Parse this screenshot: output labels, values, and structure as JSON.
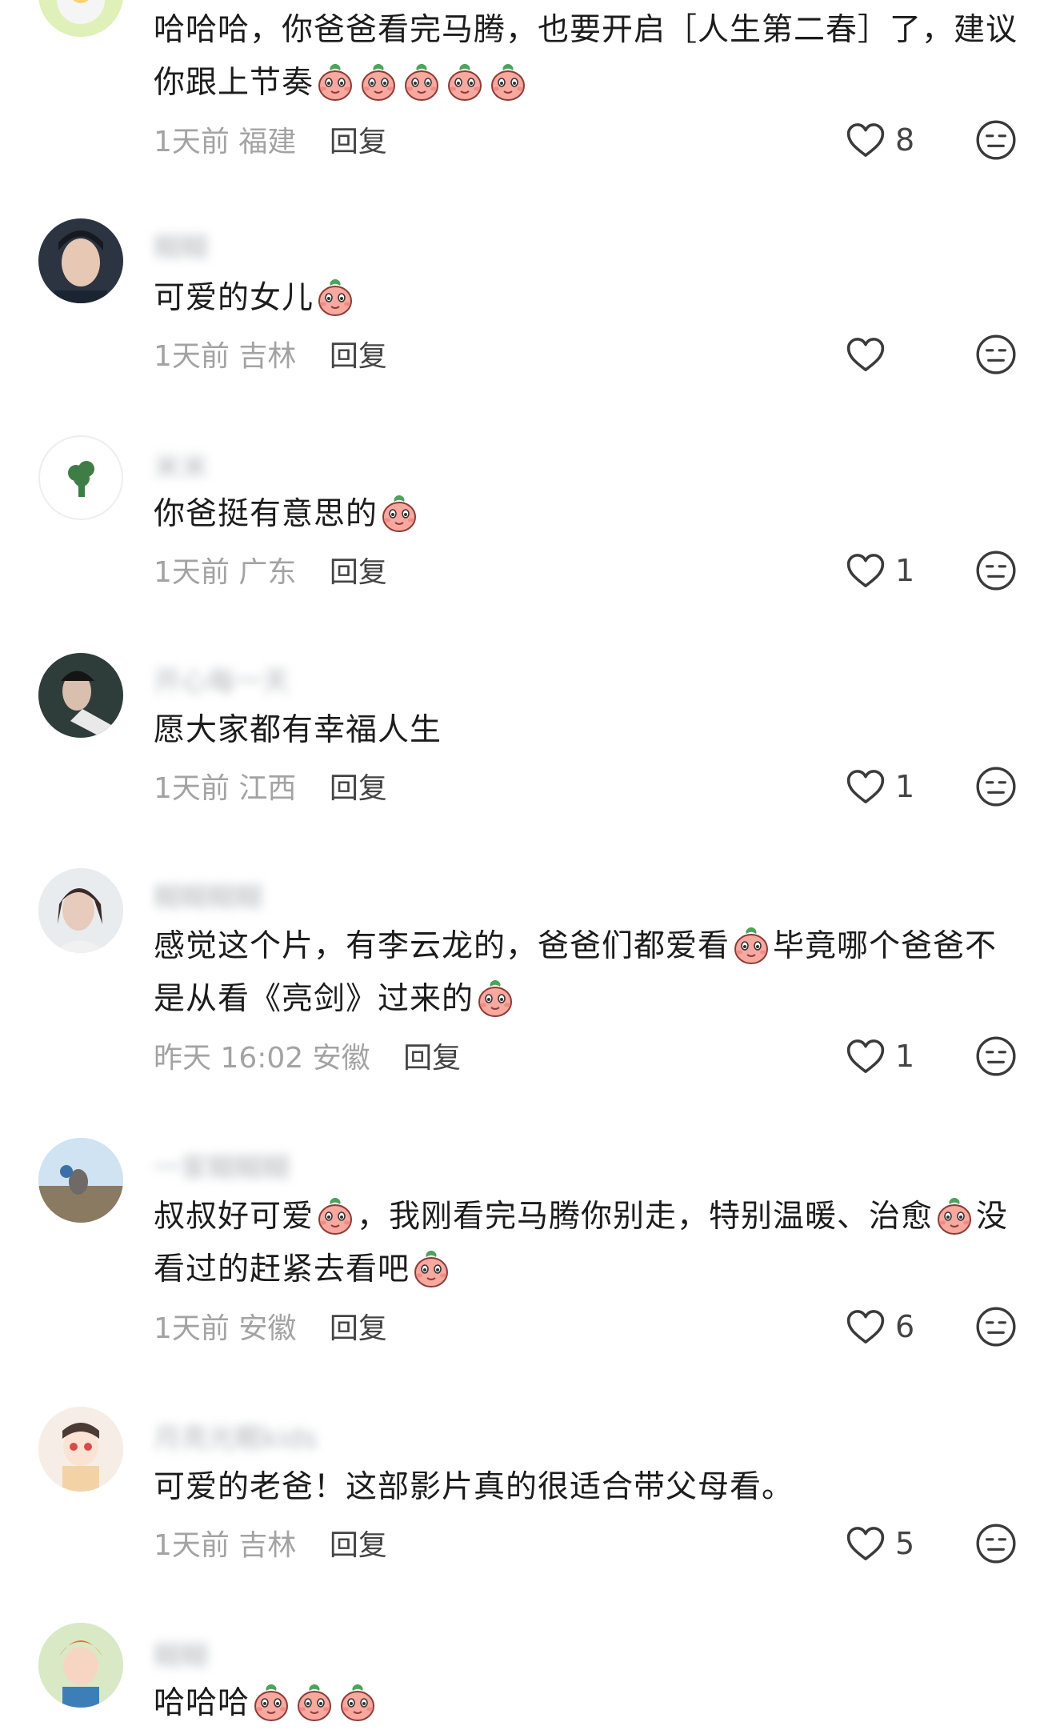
{
  "reply_label": "回复",
  "comments": [
    {
      "username": "blurred-name",
      "text_parts": [
        "哈哈哈，你爸爸看完马腾，也要开启［人生第二春］了，建议你跟上节奏",
        "",
        "",
        "",
        "",
        ""
      ],
      "time": "1天前",
      "location": "福建",
      "likes": "8"
    },
    {
      "username": "糊糊",
      "text_parts": [
        "可爱的女儿",
        ""
      ],
      "time": "1天前",
      "location": "吉林",
      "likes": ""
    },
    {
      "username": "米米",
      "text_parts": [
        "你爸挺有意思的",
        ""
      ],
      "time": "1天前",
      "location": "广东",
      "likes": "1"
    },
    {
      "username": "开心每一天",
      "text_parts": [
        "愿大家都有幸福人生"
      ],
      "time": "1天前",
      "location": "江西",
      "likes": "1"
    },
    {
      "username": "糊糊糊糊",
      "text_parts": [
        "感觉这个片，有李云龙的，爸爸们都爱看",
        "毕竟哪个爸爸不是从看《亮剑》过来的",
        ""
      ],
      "time": "昨天 16:02",
      "location": "安徽",
      "likes": "1"
    },
    {
      "username": "一家糊糊糊",
      "text_parts": [
        "叔叔好可爱",
        "，我刚看完马腾你别走，特别温暖、治愈",
        "没看过的赶紧去看吧",
        ""
      ],
      "time": "1天前",
      "location": "安徽",
      "likes": "6"
    },
    {
      "username": "月亮光眠kids",
      "text_parts": [
        "可爱的老爸！这部影片真的很适合带父母看。"
      ],
      "time": "1天前",
      "location": "吉林",
      "likes": "5"
    },
    {
      "username": "糊糊",
      "text_parts": [
        "哈哈哈",
        "",
        "",
        ""
      ],
      "time": "",
      "location": "",
      "likes": ""
    }
  ],
  "icons": {
    "emoji": "peach-face-emoji",
    "emoji_cry": "crying-emoji",
    "emoji_shy": "shy-emoji",
    "emoji_kiss": "kiss-emoji",
    "like": "heart-outline-icon",
    "dislike": "neutral-face-icon"
  },
  "colors": {
    "emoji_skin": "#f7a9a0",
    "emoji_leaf": "#4ca35b",
    "meta_gray": "#a3a3a3",
    "text": "#1c1c1c"
  }
}
